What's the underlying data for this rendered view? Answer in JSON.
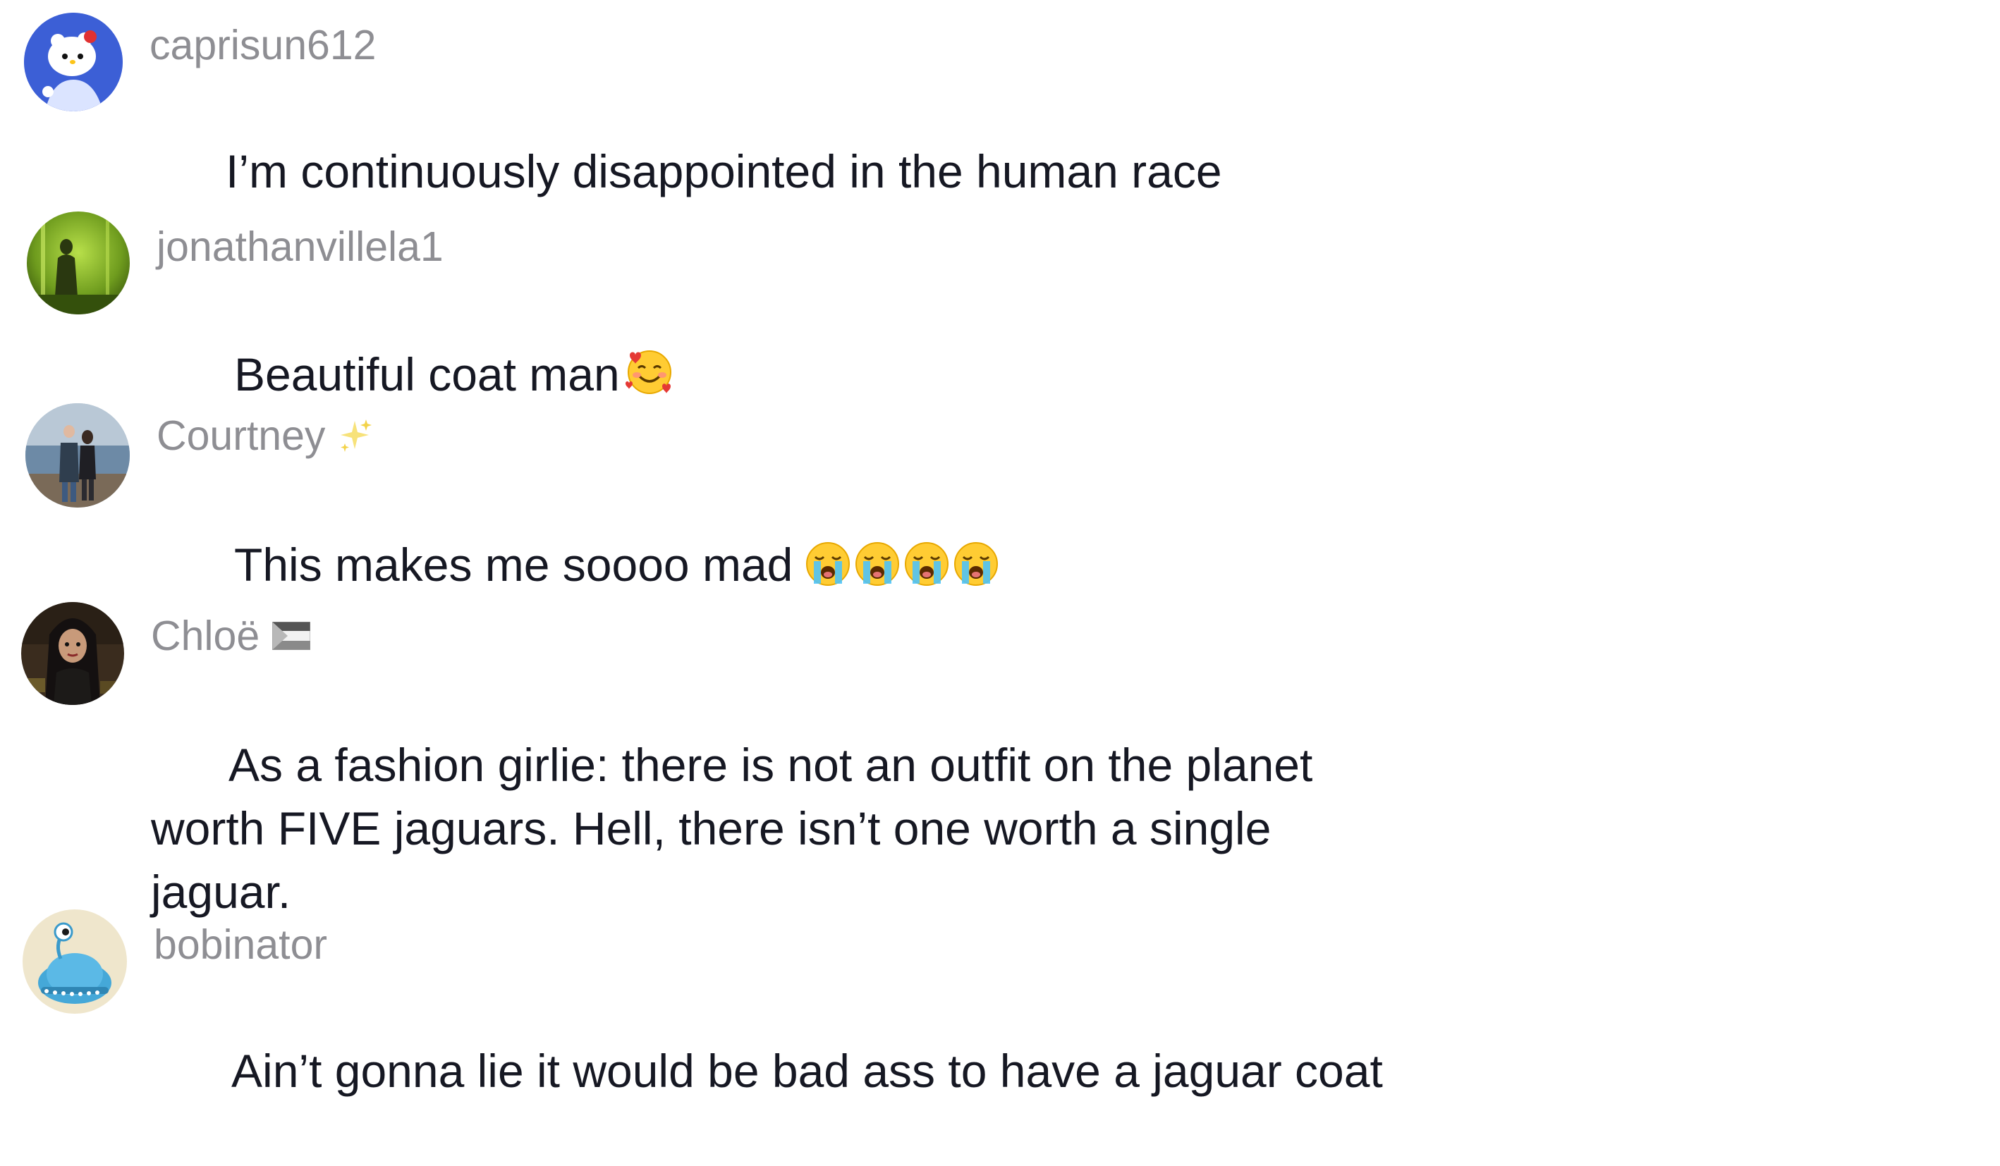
{
  "comments": [
    {
      "username": "caprisun612",
      "text": "I’m continuously disappointed in the human race",
      "avatar_icon": "hello-kitty-avatar",
      "emojis": []
    },
    {
      "username": "jonathanvillela1",
      "text": "Beautiful coat man",
      "avatar_icon": "green-silhouette-avatar",
      "emojis": [
        "smiling-face-with-hearts-emoji"
      ]
    },
    {
      "username": "Courtney",
      "username_icon": "sparkles-icon",
      "text": "This makes me soooo mad",
      "avatar_icon": "couple-photo-avatar",
      "emojis": [
        "loudly-crying-face-emoji",
        "loudly-crying-face-emoji",
        "loudly-crying-face-emoji",
        "loudly-crying-face-emoji"
      ]
    },
    {
      "username": "Chloë",
      "username_icon": "palestine-flag-icon",
      "text": "As a fashion girlie: there is not an outfit on the planet\nworth FIVE jaguars. Hell, there isn’t one worth a single\njaguar.",
      "avatar_icon": "cartoon-girl-avatar",
      "emojis": []
    },
    {
      "username": "bobinator",
      "text": "Ain’t gonna lie it would be bad ass to have a jaguar coat",
      "avatar_icon": "blue-alien-avatar",
      "emojis": []
    }
  ],
  "colors": {
    "username": "#8e8e93",
    "text": "#161823",
    "background": "#ffffff"
  }
}
